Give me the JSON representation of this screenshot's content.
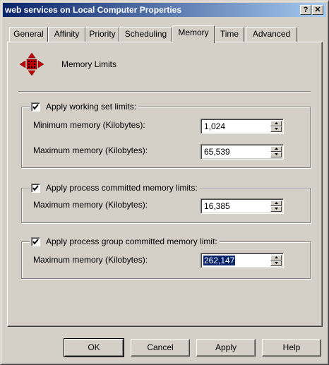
{
  "window": {
    "title": "web services on Local Computer Properties",
    "help_button": "?",
    "close_button": "✕"
  },
  "tabs": [
    {
      "label": "General",
      "active": false
    },
    {
      "label": "Affinity",
      "active": false
    },
    {
      "label": "Priority",
      "active": false
    },
    {
      "label": "Scheduling",
      "active": false
    },
    {
      "label": "Memory",
      "active": true
    },
    {
      "label": "Time",
      "active": false
    },
    {
      "label": "Advanced",
      "active": false
    }
  ],
  "header": {
    "icon": "memory-limits-icon",
    "label": "Memory Limits"
  },
  "working_set": {
    "checkbox_label": "Apply working set limits:",
    "checked": true,
    "min_label": "Minimum memory (Kilobytes):",
    "min_value": "1,024",
    "max_label": "Maximum memory (Kilobytes):",
    "max_value": "65,539"
  },
  "process_committed": {
    "checkbox_label": "Apply process committed memory limits:",
    "checked": true,
    "max_label": "Maximum memory (Kilobytes):",
    "max_value": "16,385"
  },
  "group_committed": {
    "checkbox_label": "Apply process group committed memory limit:",
    "checked": true,
    "max_label": "Maximum memory (Kilobytes):",
    "max_value": "262,147"
  },
  "buttons": {
    "ok": "OK",
    "cancel": "Cancel",
    "apply": "Apply",
    "help": "Help"
  },
  "colors": {
    "face": "#d4d0c8",
    "title_start": "#0a246a",
    "title_end": "#a6caf0",
    "selection": "#0a246a",
    "icon_red": "#c00000"
  }
}
